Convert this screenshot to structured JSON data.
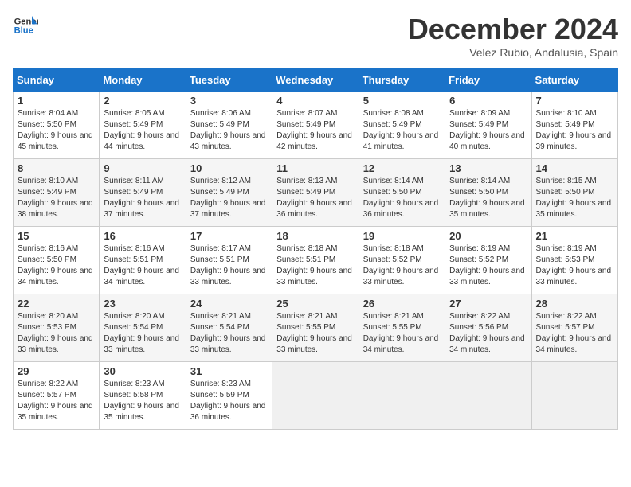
{
  "logo": {
    "line1": "General",
    "line2": "Blue"
  },
  "title": "December 2024",
  "subtitle": "Velez Rubio, Andalusia, Spain",
  "days_of_week": [
    "Sunday",
    "Monday",
    "Tuesday",
    "Wednesday",
    "Thursday",
    "Friday",
    "Saturday"
  ],
  "weeks": [
    [
      {
        "day": "1",
        "sunrise": "Sunrise: 8:04 AM",
        "sunset": "Sunset: 5:50 PM",
        "daylight": "Daylight: 9 hours and 45 minutes."
      },
      {
        "day": "2",
        "sunrise": "Sunrise: 8:05 AM",
        "sunset": "Sunset: 5:49 PM",
        "daylight": "Daylight: 9 hours and 44 minutes."
      },
      {
        "day": "3",
        "sunrise": "Sunrise: 8:06 AM",
        "sunset": "Sunset: 5:49 PM",
        "daylight": "Daylight: 9 hours and 43 minutes."
      },
      {
        "day": "4",
        "sunrise": "Sunrise: 8:07 AM",
        "sunset": "Sunset: 5:49 PM",
        "daylight": "Daylight: 9 hours and 42 minutes."
      },
      {
        "day": "5",
        "sunrise": "Sunrise: 8:08 AM",
        "sunset": "Sunset: 5:49 PM",
        "daylight": "Daylight: 9 hours and 41 minutes."
      },
      {
        "day": "6",
        "sunrise": "Sunrise: 8:09 AM",
        "sunset": "Sunset: 5:49 PM",
        "daylight": "Daylight: 9 hours and 40 minutes."
      },
      {
        "day": "7",
        "sunrise": "Sunrise: 8:10 AM",
        "sunset": "Sunset: 5:49 PM",
        "daylight": "Daylight: 9 hours and 39 minutes."
      }
    ],
    [
      {
        "day": "8",
        "sunrise": "Sunrise: 8:10 AM",
        "sunset": "Sunset: 5:49 PM",
        "daylight": "Daylight: 9 hours and 38 minutes."
      },
      {
        "day": "9",
        "sunrise": "Sunrise: 8:11 AM",
        "sunset": "Sunset: 5:49 PM",
        "daylight": "Daylight: 9 hours and 37 minutes."
      },
      {
        "day": "10",
        "sunrise": "Sunrise: 8:12 AM",
        "sunset": "Sunset: 5:49 PM",
        "daylight": "Daylight: 9 hours and 37 minutes."
      },
      {
        "day": "11",
        "sunrise": "Sunrise: 8:13 AM",
        "sunset": "Sunset: 5:49 PM",
        "daylight": "Daylight: 9 hours and 36 minutes."
      },
      {
        "day": "12",
        "sunrise": "Sunrise: 8:14 AM",
        "sunset": "Sunset: 5:50 PM",
        "daylight": "Daylight: 9 hours and 36 minutes."
      },
      {
        "day": "13",
        "sunrise": "Sunrise: 8:14 AM",
        "sunset": "Sunset: 5:50 PM",
        "daylight": "Daylight: 9 hours and 35 minutes."
      },
      {
        "day": "14",
        "sunrise": "Sunrise: 8:15 AM",
        "sunset": "Sunset: 5:50 PM",
        "daylight": "Daylight: 9 hours and 35 minutes."
      }
    ],
    [
      {
        "day": "15",
        "sunrise": "Sunrise: 8:16 AM",
        "sunset": "Sunset: 5:50 PM",
        "daylight": "Daylight: 9 hours and 34 minutes."
      },
      {
        "day": "16",
        "sunrise": "Sunrise: 8:16 AM",
        "sunset": "Sunset: 5:51 PM",
        "daylight": "Daylight: 9 hours and 34 minutes."
      },
      {
        "day": "17",
        "sunrise": "Sunrise: 8:17 AM",
        "sunset": "Sunset: 5:51 PM",
        "daylight": "Daylight: 9 hours and 33 minutes."
      },
      {
        "day": "18",
        "sunrise": "Sunrise: 8:18 AM",
        "sunset": "Sunset: 5:51 PM",
        "daylight": "Daylight: 9 hours and 33 minutes."
      },
      {
        "day": "19",
        "sunrise": "Sunrise: 8:18 AM",
        "sunset": "Sunset: 5:52 PM",
        "daylight": "Daylight: 9 hours and 33 minutes."
      },
      {
        "day": "20",
        "sunrise": "Sunrise: 8:19 AM",
        "sunset": "Sunset: 5:52 PM",
        "daylight": "Daylight: 9 hours and 33 minutes."
      },
      {
        "day": "21",
        "sunrise": "Sunrise: 8:19 AM",
        "sunset": "Sunset: 5:53 PM",
        "daylight": "Daylight: 9 hours and 33 minutes."
      }
    ],
    [
      {
        "day": "22",
        "sunrise": "Sunrise: 8:20 AM",
        "sunset": "Sunset: 5:53 PM",
        "daylight": "Daylight: 9 hours and 33 minutes."
      },
      {
        "day": "23",
        "sunrise": "Sunrise: 8:20 AM",
        "sunset": "Sunset: 5:54 PM",
        "daylight": "Daylight: 9 hours and 33 minutes."
      },
      {
        "day": "24",
        "sunrise": "Sunrise: 8:21 AM",
        "sunset": "Sunset: 5:54 PM",
        "daylight": "Daylight: 9 hours and 33 minutes."
      },
      {
        "day": "25",
        "sunrise": "Sunrise: 8:21 AM",
        "sunset": "Sunset: 5:55 PM",
        "daylight": "Daylight: 9 hours and 33 minutes."
      },
      {
        "day": "26",
        "sunrise": "Sunrise: 8:21 AM",
        "sunset": "Sunset: 5:55 PM",
        "daylight": "Daylight: 9 hours and 34 minutes."
      },
      {
        "day": "27",
        "sunrise": "Sunrise: 8:22 AM",
        "sunset": "Sunset: 5:56 PM",
        "daylight": "Daylight: 9 hours and 34 minutes."
      },
      {
        "day": "28",
        "sunrise": "Sunrise: 8:22 AM",
        "sunset": "Sunset: 5:57 PM",
        "daylight": "Daylight: 9 hours and 34 minutes."
      }
    ],
    [
      {
        "day": "29",
        "sunrise": "Sunrise: 8:22 AM",
        "sunset": "Sunset: 5:57 PM",
        "daylight": "Daylight: 9 hours and 35 minutes."
      },
      {
        "day": "30",
        "sunrise": "Sunrise: 8:23 AM",
        "sunset": "Sunset: 5:58 PM",
        "daylight": "Daylight: 9 hours and 35 minutes."
      },
      {
        "day": "31",
        "sunrise": "Sunrise: 8:23 AM",
        "sunset": "Sunset: 5:59 PM",
        "daylight": "Daylight: 9 hours and 36 minutes."
      },
      null,
      null,
      null,
      null
    ]
  ]
}
